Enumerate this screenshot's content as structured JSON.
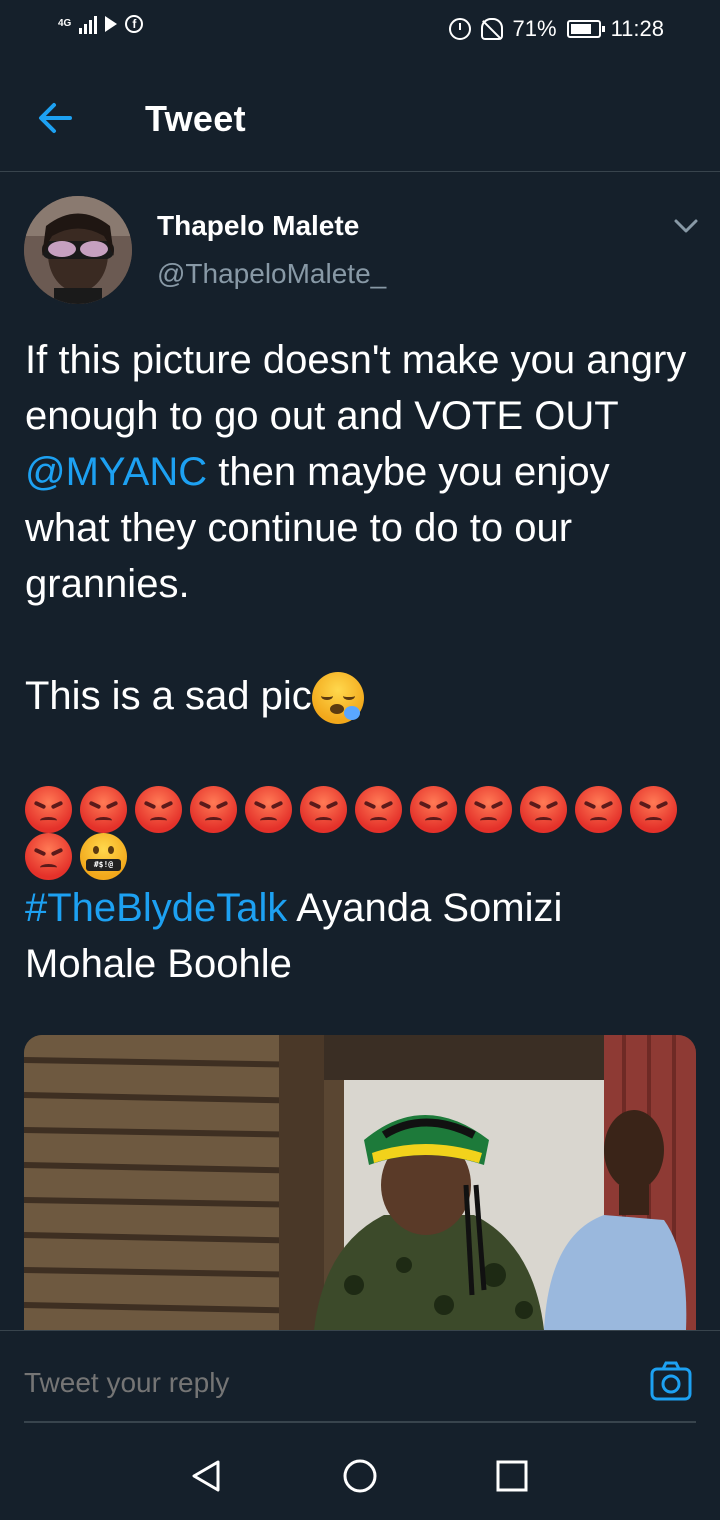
{
  "status_bar": {
    "network": "4G",
    "battery": "71%",
    "time": "11:28",
    "icons": [
      "signal-icon",
      "play-store-icon",
      "facebook-icon",
      "alarm-icon",
      "bell-off-icon",
      "battery-icon"
    ]
  },
  "header": {
    "title": "Tweet",
    "back_icon": "arrow-left-icon"
  },
  "tweet": {
    "author_name": "Thapelo Malete",
    "author_handle": "@ThapeloMalete_",
    "text_line1": "If this picture doesn't make you angry enough to go out and VOTE OUT ",
    "mention": "@MYANC",
    "text_line1_end": " then maybe you enjoy what they continue to do to our grannies.",
    "text_line2": "This is a sad pic",
    "emoji_sad": "sleepy-face-emoji",
    "angry_emoji_count": 13,
    "cursing_emoji": "face-with-symbols-on-mouth-emoji",
    "cursing_symbols": "#$!@",
    "hashtag": "#TheBlydeTalk",
    "text_end": " Ayanda Somizi Mohale Boohle"
  },
  "reply": {
    "placeholder": "Tweet your reply",
    "camera_icon": "camera-icon"
  },
  "nav": {
    "icons": [
      "back-triangle-icon",
      "home-circle-icon",
      "recents-square-icon"
    ]
  },
  "colors": {
    "background": "#15202b",
    "link": "#1da1f2",
    "secondary_text": "#8899a6",
    "divider": "#38444d"
  }
}
